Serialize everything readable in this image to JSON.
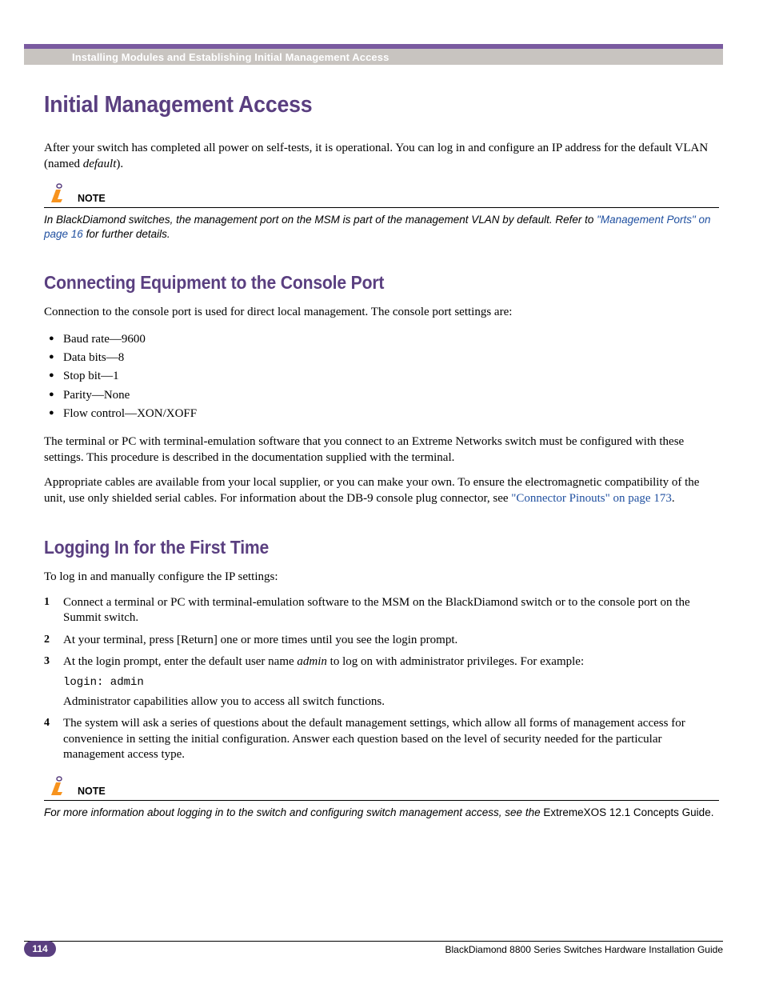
{
  "header": "Installing Modules and Establishing Initial Management Access",
  "h1": "Initial Management Access",
  "intro_a": "After your switch has completed all power on self-tests, it is operational. You can log in and configure an IP address for the default VLAN (named ",
  "intro_b": "default",
  "intro_c": ").",
  "note1": {
    "label": "NOTE",
    "text_a": "In BlackDiamond switches, the management port on the MSM is part of the management VLAN by default. Refer to ",
    "link": "\"Management Ports\" on page 16",
    "text_b": " for further details."
  },
  "sec1": {
    "title": "Connecting Equipment to the Console Port",
    "p1": "Connection to the console port is used for direct local management. The console port settings are:",
    "bullets": [
      "Baud rate—9600",
      "Data bits—8",
      "Stop bit—1",
      "Parity—None",
      "Flow control—XON/XOFF"
    ],
    "p2": "The terminal or PC with terminal-emulation software that you connect to an Extreme Networks switch must be configured with these settings. This procedure is described in the documentation supplied with the terminal.",
    "p3_a": "Appropriate cables are available from your local supplier, or you can make your own. To ensure the electromagnetic compatibility of the unit, use only shielded serial cables. For information about the DB-9 console plug connector, see ",
    "p3_link": "\"Connector Pinouts\" on page 173",
    "p3_b": "."
  },
  "sec2": {
    "title": "Logging In for the First Time",
    "p1": "To log in and manually configure the IP settings:",
    "steps": {
      "s1": "Connect a terminal or PC with terminal-emulation software to the MSM on the BlackDiamond switch or to the console port on the Summit switch.",
      "s2": "At your terminal, press [Return] one or more times until you see the login prompt.",
      "s3_a": "At the login prompt, enter the default user name ",
      "s3_i": "admin",
      "s3_b": " to log on with administrator privileges. For example:",
      "s3_code": "login: admin",
      "s3_c": "Administrator capabilities allow you to access all switch functions.",
      "s4": "The system will ask a series of questions about the default management settings, which allow all forms of management access for convenience in setting the initial configuration. Answer each question based on the level of security needed for the particular management access type."
    }
  },
  "note2": {
    "label": "NOTE",
    "text_a": "For more information about logging in to the switch and configuring switch management access, see the ",
    "text_b": "ExtremeXOS 12.1 Concepts Guide."
  },
  "footer": {
    "page": "114",
    "title": "BlackDiamond 8800 Series Switches Hardware Installation Guide"
  }
}
